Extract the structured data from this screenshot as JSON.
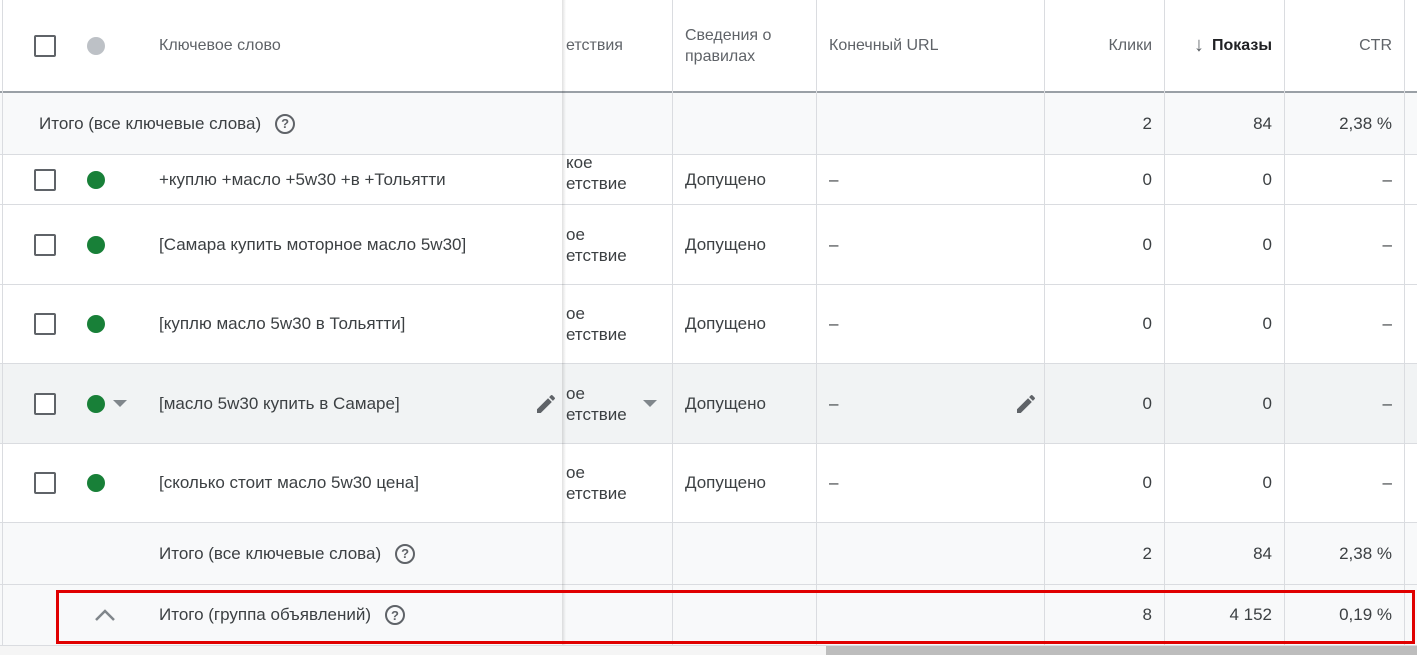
{
  "header": {
    "keyword_col": "Ключевое слово",
    "match_col": "етствия",
    "policy_col": "Сведения о правилах",
    "url_col": "Конечный URL",
    "clicks_col": "Клики",
    "impr_col": "Показы",
    "ctr_col": "CTR",
    "sort_arrow": "↓"
  },
  "total_top": {
    "label": "Итого (все ключевые слова)",
    "clicks": "2",
    "impr": "84",
    "ctr": "2,38 %"
  },
  "rows": [
    {
      "keyword": "+куплю +масло +5w30 +в +Тольятти",
      "match1": "кое",
      "match2": "етствие",
      "policy": "Допущено",
      "url": "–",
      "clicks": "0",
      "impr": "0",
      "ctr": "–"
    },
    {
      "keyword": "[Самара купить моторное масло 5w30]",
      "match1": "ое",
      "match2": "етствие",
      "policy": "Допущено",
      "url": "–",
      "clicks": "0",
      "impr": "0",
      "ctr": "–"
    },
    {
      "keyword": "[куплю масло 5w30 в Тольятти]",
      "match1": "ое",
      "match2": "етствие",
      "policy": "Допущено",
      "url": "–",
      "clicks": "0",
      "impr": "0",
      "ctr": "–"
    },
    {
      "keyword": "[масло 5w30 купить в Самаре]",
      "match1": "ое",
      "match2": "етствие",
      "policy": "Допущено",
      "url": "–",
      "clicks": "0",
      "impr": "0",
      "ctr": "–"
    },
    {
      "keyword": "[сколько стоит масло 5w30 цена]",
      "match1": "ое",
      "match2": "етствие",
      "policy": "Допущено",
      "url": "–",
      "clicks": "0",
      "impr": "0",
      "ctr": "–"
    }
  ],
  "total_keywords": {
    "label": "Итого (все ключевые слова)",
    "clicks": "2",
    "impr": "84",
    "ctr": "2,38 %"
  },
  "total_adgroup": {
    "label": "Итого (группа объявлений)",
    "clicks": "8",
    "impr": "4 152",
    "ctr": "0,19 %"
  },
  "icons": {
    "help": "help-circle-icon",
    "edit": "pencil-icon",
    "expand": "chevron-up-icon",
    "sort": "arrow-down-icon"
  },
  "colors": {
    "status_green": "#188038",
    "highlight_red": "#e00000"
  }
}
